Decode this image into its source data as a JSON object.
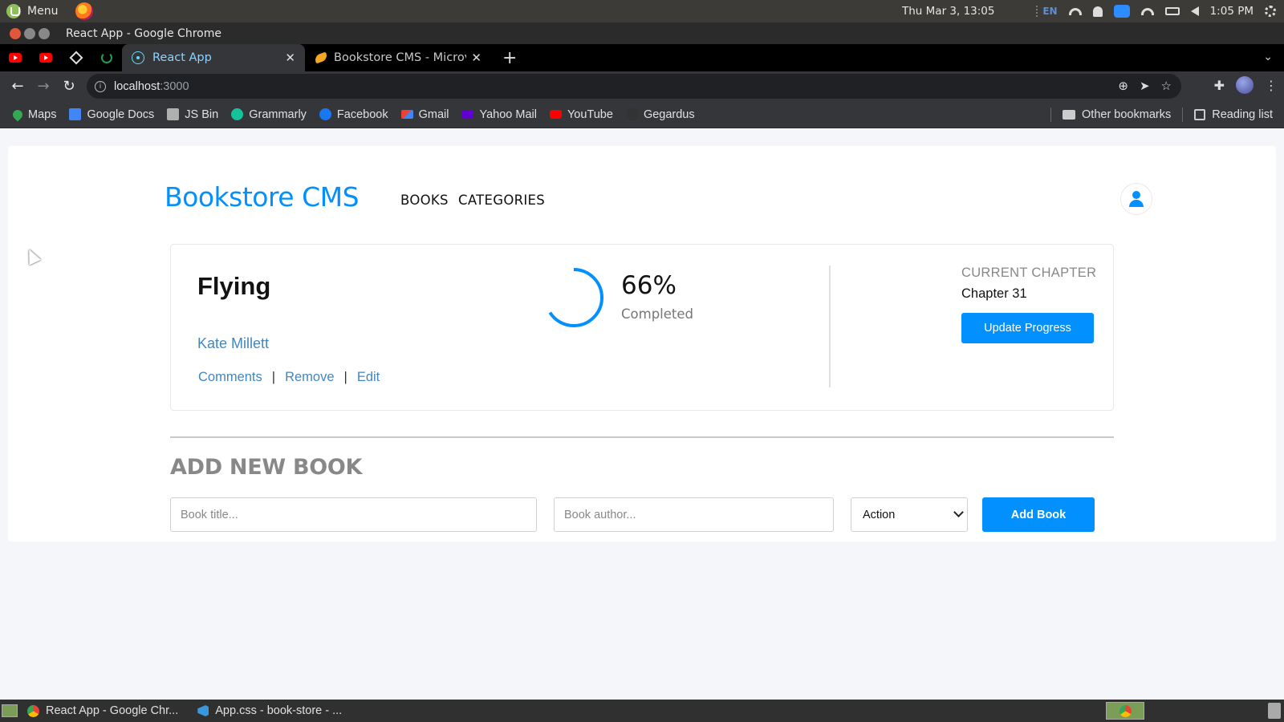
{
  "os": {
    "menu_label": "Menu",
    "clock": "Thu Mar  3, 13:05",
    "lang": "EN",
    "time": "1:05 PM"
  },
  "window": {
    "title": "React App - Google Chrome"
  },
  "tabs": [
    {
      "title": "React App",
      "close": "✕"
    },
    {
      "title": "Bookstore CMS - Microver",
      "close": "✕"
    }
  ],
  "newtab": "+",
  "address": {
    "host": "localhost",
    "port": ":3000"
  },
  "bookmarks": [
    {
      "label": "Maps",
      "icon": "maps-icon",
      "color": "#34a853"
    },
    {
      "label": "Google Docs",
      "icon": "docs-icon",
      "color": "#4285f4"
    },
    {
      "label": "JS Bin",
      "icon": "jsbin-icon",
      "color": "#b0b0b0"
    },
    {
      "label": "Grammarly",
      "icon": "grammarly-icon",
      "color": "#15c39a"
    },
    {
      "label": "Facebook",
      "icon": "facebook-icon",
      "color": "#1877f2"
    },
    {
      "label": "Gmail",
      "icon": "gmail-icon",
      "color": "#ea4335"
    },
    {
      "label": "Yahoo Mail",
      "icon": "yahoo-icon",
      "color": "#6001d2"
    },
    {
      "label": "YouTube",
      "icon": "youtube-icon",
      "color": "#ff0000"
    },
    {
      "label": "Gegardus",
      "icon": "github-icon",
      "color": "#333333"
    }
  ],
  "bookmarks_right": {
    "other": "Other bookmarks",
    "reading": "Reading list"
  },
  "app": {
    "brand": "Bookstore CMS",
    "nav": [
      "BOOKS",
      "CATEGORIES"
    ],
    "accent_color": "#0290ff"
  },
  "book": {
    "title": "Flying",
    "author": "Kate Millett",
    "actions": [
      "Comments",
      "Remove",
      "Edit"
    ],
    "separator": "|",
    "progress_percent": 66,
    "progress_label": "66%",
    "completed_label": "Completed",
    "current_chapter_label": "CURRENT CHAPTER",
    "current_chapter": "Chapter 31",
    "update_button": "Update Progress"
  },
  "form": {
    "title": "ADD NEW BOOK",
    "title_placeholder": "Book title...",
    "author_placeholder": "Book author...",
    "category_selected": "Action",
    "add_button": "Add Book"
  },
  "taskbar": [
    {
      "label": "React App - Google Chr...",
      "icon": "chrome-icon"
    },
    {
      "label": "App.css - book-store - ...",
      "icon": "vscode-icon"
    }
  ]
}
